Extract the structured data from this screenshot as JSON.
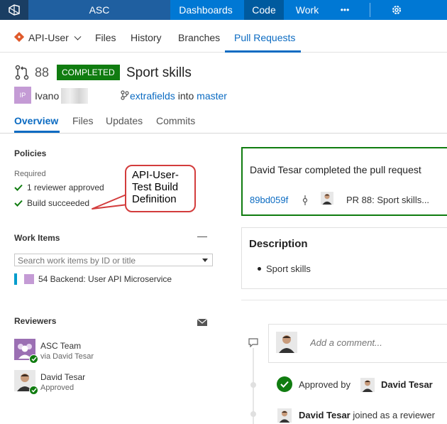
{
  "topbar": {
    "project": "ASC",
    "nav": [
      "Dashboards",
      "Code",
      "Work"
    ],
    "more": "•••"
  },
  "subnav": {
    "repo": "API-User",
    "items": [
      "Files",
      "History",
      "Branches",
      "Pull Requests"
    ]
  },
  "pr": {
    "number": "88",
    "status": "COMPLETED",
    "title": "Sport skills",
    "avatar_initials": "IP",
    "author": "Ivano",
    "source_branch": "extrafields",
    "into": "into",
    "target_branch": "master",
    "tabs": [
      "Overview",
      "Files",
      "Updates",
      "Commits"
    ]
  },
  "policies": {
    "title": "Policies",
    "required_label": "Required",
    "items": [
      "1 reviewer approved",
      "Build succeeded"
    ]
  },
  "callout": {
    "text_lines": [
      "API-User-",
      "Test Build",
      "Definition"
    ]
  },
  "work_items": {
    "title": "Work Items",
    "collapse": "—",
    "search_placeholder": "Search work items by ID or title",
    "items": [
      "54 Backend: User API Microservice"
    ]
  },
  "reviewers": {
    "title": "Reviewers",
    "items": [
      {
        "name": "ASC Team",
        "sub": "via David Tesar"
      },
      {
        "name": "David Tesar",
        "sub": "Approved"
      }
    ]
  },
  "completion": {
    "message": "David Tesar completed the pull request",
    "commit": "89bd059f",
    "pr_ref": "PR 88: Sport skills..."
  },
  "description": {
    "title": "Description",
    "bullets": [
      "Sport skills"
    ]
  },
  "comments": {
    "placeholder": "Add a comment..."
  },
  "events": {
    "approved_prefix": "Approved by",
    "approved_by": "David Tesar",
    "joined_name": "David Tesar",
    "joined_text": "joined as a reviewer"
  },
  "colors": {
    "topbar": "#0078d4",
    "accent": "#0b6bc2",
    "success": "#107c10",
    "callout_border": "#d33c3c"
  }
}
